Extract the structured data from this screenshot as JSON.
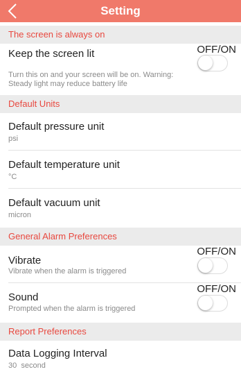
{
  "header": {
    "title": "Setting",
    "back_icon": "chevron-left-icon"
  },
  "sections": {
    "screen": "The screen is always on",
    "units": "Default Units",
    "alarm": "General Alarm Preferences",
    "report": "Report Preferences"
  },
  "screen_lit": {
    "label": "Keep the screen lit",
    "toggle_label": "OFF/ON",
    "desc": "Turn this on and your screen will be on. Warning: Steady light may reduce battery life",
    "on": false
  },
  "units": {
    "pressure": {
      "label": "Default pressure unit",
      "value": "psi"
    },
    "temperature": {
      "label": "Default temperature unit",
      "value": "°C"
    },
    "vacuum": {
      "label": "Default vacuum unit",
      "value": "micron"
    }
  },
  "alarm": {
    "vibrate": {
      "label": "Vibrate",
      "desc": "Vibrate when the alarm is triggered",
      "toggle_label": "OFF/ON",
      "on": false
    },
    "sound": {
      "label": "Sound",
      "desc": "Prompted when the alarm is triggered",
      "toggle_label": "OFF/ON",
      "on": false
    }
  },
  "report": {
    "interval": {
      "label": "Data Logging Interval",
      "value": "30  second"
    }
  },
  "colors": {
    "header": "#f0796a",
    "section_text": "#e8483f",
    "section_bg": "#ebebeb"
  }
}
